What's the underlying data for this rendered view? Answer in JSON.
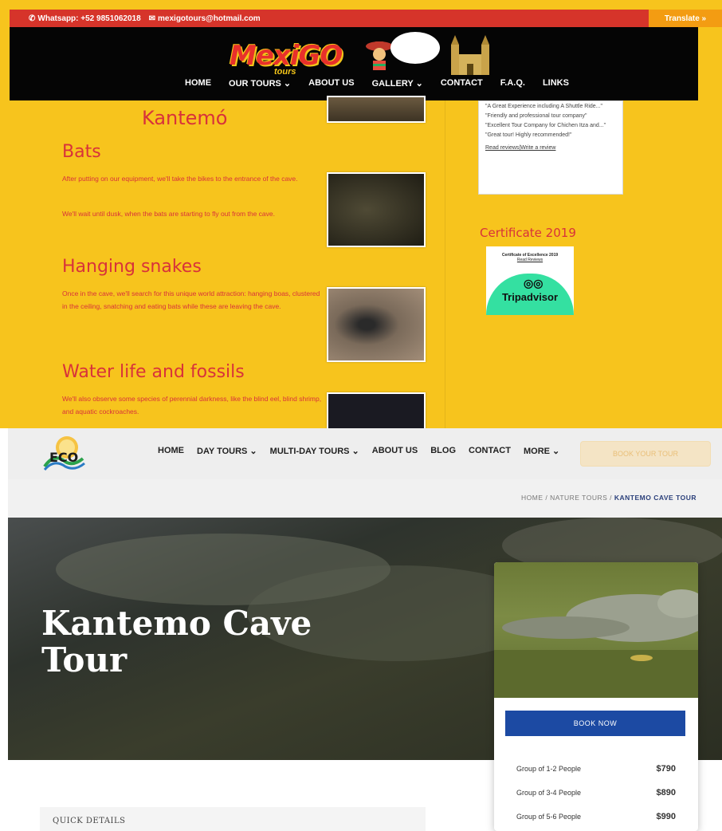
{
  "mexigo": {
    "topbar": {
      "whatsapp": "Whatsapp: +52 9851062018",
      "email": "mexigotours@hotmail.com",
      "translate": "Translate »"
    },
    "logo": {
      "text": "MexiGO",
      "sub": "tours"
    },
    "nav": [
      "HOME",
      "OUR TOURS ⌄",
      "ABOUT US",
      "GALLERY ⌄",
      "CONTACT",
      "F.A.Q.",
      "LINKS"
    ],
    "content": {
      "title": "Kantemó",
      "sections": [
        {
          "heading": "Bats",
          "paragraphs": [
            "After putting on our equipment, we'll take the bikes to the entrance of the cave.",
            "We'll wait until dusk, when the bats are starting to fly out from the cave."
          ]
        },
        {
          "heading": "Hanging snakes",
          "paragraphs": [
            "Once in the cave, we'll search for this unique world attraction: hanging boas, clustered in the ceiling, snatching and eating bats while these are leaving the cave."
          ]
        },
        {
          "heading": "Water life and fossils",
          "paragraphs": [
            "We'll also observe some species of perennial darkness, like the blind eel, blind shrimp, and aquatic cockroaches."
          ]
        }
      ]
    },
    "reviews": {
      "items": [
        "\"A Great Experience including A Shuttle Ride...\"",
        "\"Friendly and professional tour company\"",
        "\"Excellent Tour Company for Chichen Itza and...\"",
        "\"Great tour! Highly recommended!\""
      ],
      "link": "Read reviews|Write a review"
    },
    "certificate": {
      "title": "Certificate 2019",
      "line1": "Certificate of Excellence 2019",
      "line2": "Read Reviews",
      "brand": "Tripadvisor"
    }
  },
  "eco": {
    "nav": [
      "HOME",
      "DAY TOURS ⌄",
      "MULTI-DAY TOURS ⌄",
      "ABOUT US",
      "BLOG",
      "CONTACT",
      "MORE ⌄"
    ],
    "cta": "BOOK YOUR TOUR",
    "breadcrumb": {
      "home": "HOME",
      "sep": "/",
      "mid": "NATURE TOURS",
      "current": "KANTEMO CAVE TOUR"
    },
    "hero": {
      "title_line1": "Kantemo Cave",
      "title_line2": "Tour"
    },
    "card": {
      "book": "BOOK NOW",
      "prices": [
        {
          "label": "Group of 1-2 People",
          "amount": "$790"
        },
        {
          "label": "Group of 3-4 People",
          "amount": "$890"
        },
        {
          "label": "Group of 5-6 People",
          "amount": "$990"
        }
      ]
    },
    "quick_details": "QUICK DETAILS"
  }
}
